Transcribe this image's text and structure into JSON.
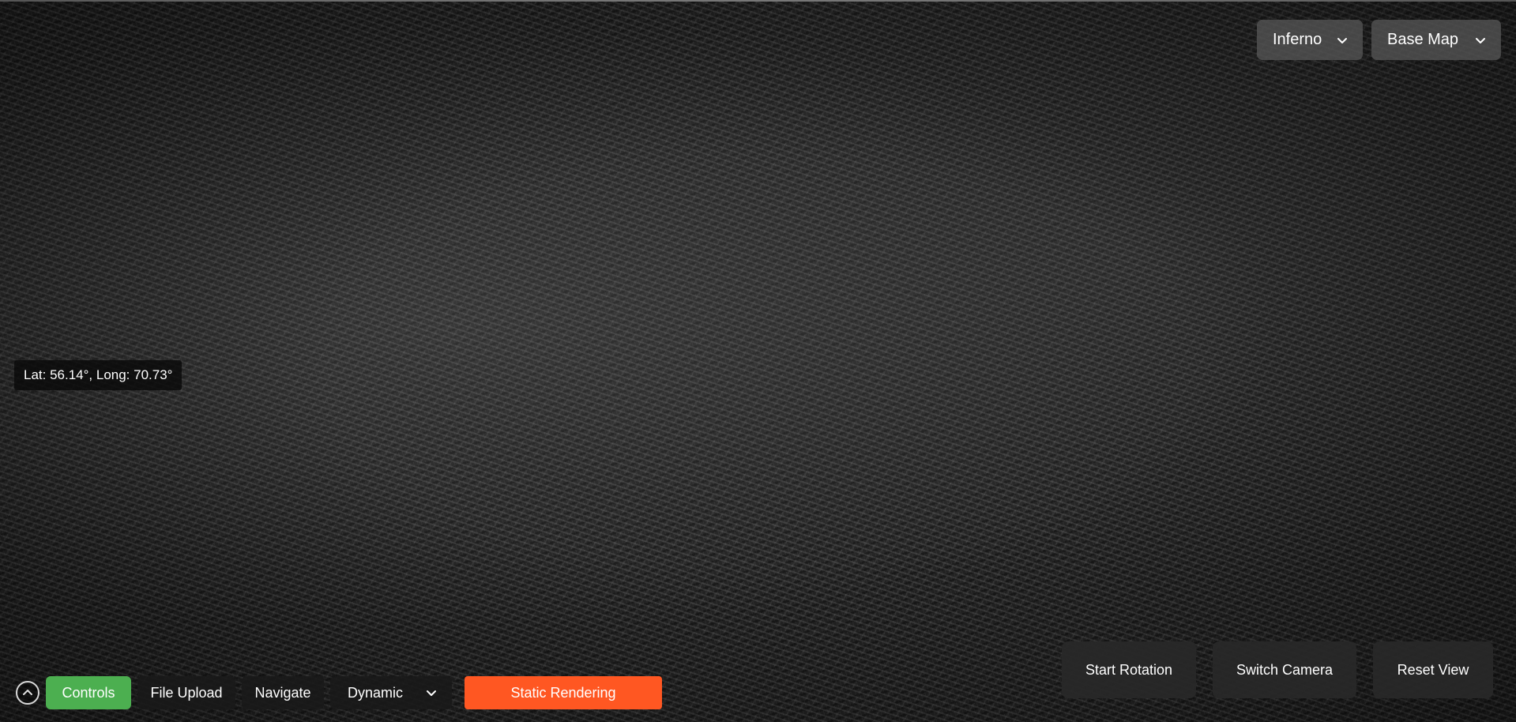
{
  "top_controls": {
    "colormap_select": {
      "value": "Inferno",
      "icon": "chevron-down-icon"
    },
    "basemap_select": {
      "value": "Base Map",
      "icon": "chevron-down-icon"
    }
  },
  "coordinate_readout": {
    "text": "Lat: 56.14°, Long: 70.73°"
  },
  "bottom_toolbar": {
    "collapse_icon": "chevron-up-icon",
    "tabs": [
      {
        "label": "Controls",
        "active": true
      },
      {
        "label": "File Upload",
        "active": false
      },
      {
        "label": "Navigate",
        "active": false
      }
    ],
    "mode_select": {
      "value": "Dynamic",
      "icon": "chevron-down-icon"
    },
    "static_rendering_label": "Static Rendering"
  },
  "view_controls": {
    "start_rotation_label": "Start Rotation",
    "switch_camera_label": "Switch Camera",
    "reset_view_label": "Reset View"
  },
  "colors": {
    "active_tab": "#4caf50",
    "static_rendering": "#ff5722",
    "panel_dark": "#282828"
  }
}
